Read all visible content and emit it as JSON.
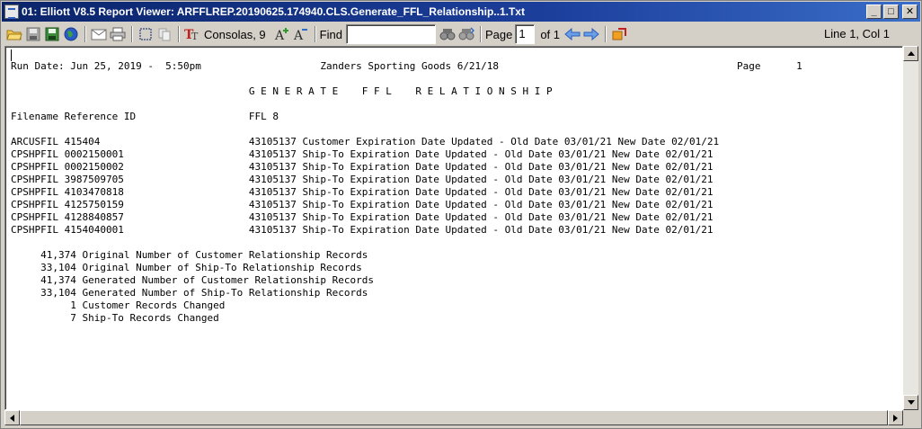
{
  "window": {
    "title": "01: Elliott V8.5 Report Viewer: ARFFLREP.20190625.174940.CLS.Generate_FFL_Relationship..1.Txt",
    "minimize": "_",
    "maximize": "□",
    "close": "✕"
  },
  "toolbar": {
    "font_label": "Consolas, 9",
    "find_label": "Find",
    "find_value": "",
    "page_label": "Page",
    "page_value": "1",
    "of_label": "of 1",
    "status": "Line 1, Col 1"
  },
  "report": {
    "header_left": "Run Date: Jun 25, 2019 -  5:50pm",
    "header_center": "Zanders Sporting Goods 6/21/18",
    "page_label": "Page",
    "page_number": "1",
    "title": "G E N E R A T E    F F L    R E L A T I O N S H I P",
    "col_filename": "Filename Reference ID",
    "col_ffl": "FFL 8",
    "rows": [
      {
        "file": "ARCUSFIL",
        "ref": "415404",
        "ffl": "43105137",
        "desc": "Customer Expiration Date Updated - Old Date 03/01/21 New Date 02/01/21"
      },
      {
        "file": "CPSHPFIL",
        "ref": "0002150001",
        "ffl": "43105137",
        "desc": "Ship-To Expiration Date Updated - Old Date 03/01/21 New Date 02/01/21"
      },
      {
        "file": "CPSHPFIL",
        "ref": "0002150002",
        "ffl": "43105137",
        "desc": "Ship-To Expiration Date Updated - Old Date 03/01/21 New Date 02/01/21"
      },
      {
        "file": "CPSHPFIL",
        "ref": "3987509705",
        "ffl": "43105137",
        "desc": "Ship-To Expiration Date Updated - Old Date 03/01/21 New Date 02/01/21"
      },
      {
        "file": "CPSHPFIL",
        "ref": "4103470818",
        "ffl": "43105137",
        "desc": "Ship-To Expiration Date Updated - Old Date 03/01/21 New Date 02/01/21"
      },
      {
        "file": "CPSHPFIL",
        "ref": "4125750159",
        "ffl": "43105137",
        "desc": "Ship-To Expiration Date Updated - Old Date 03/01/21 New Date 02/01/21"
      },
      {
        "file": "CPSHPFIL",
        "ref": "4128840857",
        "ffl": "43105137",
        "desc": "Ship-To Expiration Date Updated - Old Date 03/01/21 New Date 02/01/21"
      },
      {
        "file": "CPSHPFIL",
        "ref": "4154040001",
        "ffl": "43105137",
        "desc": "Ship-To Expiration Date Updated - Old Date 03/01/21 New Date 02/01/21"
      }
    ],
    "summary": [
      {
        "count": "41,374",
        "label": "Original Number of Customer Relationship Records"
      },
      {
        "count": "33,104",
        "label": "Original Number of Ship-To Relationship Records"
      },
      {
        "count": "41,374",
        "label": "Generated Number of Customer Relationship Records"
      },
      {
        "count": "33,104",
        "label": "Generated Number of Ship-To Relationship Records"
      },
      {
        "count": "1",
        "label": "Customer Records Changed"
      },
      {
        "count": "7",
        "label": "Ship-To Records Changed"
      }
    ]
  },
  "icons": [
    "open-folder-icon",
    "save-icon",
    "save-as-icon",
    "globe-icon",
    "email-icon",
    "print-icon",
    "select-icon",
    "copy-icon",
    "font-icon",
    "increase-font-icon",
    "decrease-font-icon",
    "find-icon",
    "find-next-icon",
    "prev-page-icon",
    "next-page-icon",
    "export-icon"
  ]
}
